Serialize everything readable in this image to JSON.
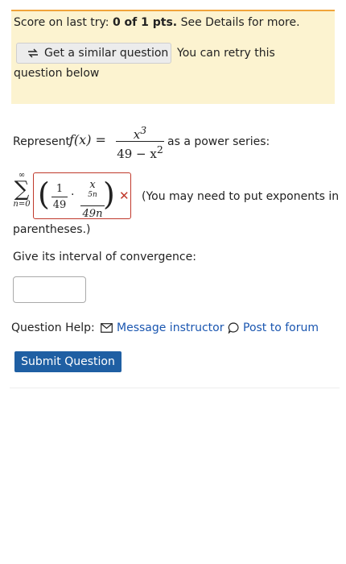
{
  "banner": {
    "score_prefix": "Score on last try: ",
    "score_value": "0 of 1 pts.",
    "score_suffix": " See Details for more.",
    "similar_button": "Get a similar question",
    "retry_line1": "You can retry this",
    "retry_line2": "question below",
    "icons": {
      "retry": "retry-icon"
    }
  },
  "question": {
    "represent_prefix": "Represent",
    "function_lhs": "f(x) =",
    "numerator": "x",
    "numerator_exp": "3",
    "denominator": "49 − x",
    "denominator_exp": "2",
    "represent_suffix": "as a power series:",
    "sum_upper": "∞",
    "sum_symbol": "∑",
    "sum_lower": "n=0",
    "answer": {
      "frac1_num": "1",
      "frac1_den": "49",
      "frac2_num": "x",
      "frac2_num_exp": "5n",
      "frac2_den": "49n",
      "status": "incorrect",
      "status_symbol": "✕"
    },
    "hint_line1": "(You may need to put exponents in",
    "hint_line2": "parentheses.)",
    "interval_label": "Give its interval of convergence:",
    "interval_value": ""
  },
  "help": {
    "label": "Question Help:",
    "message_link": "Message instructor",
    "forum_link": "Post to forum",
    "icons": {
      "message": "envelope-icon",
      "forum": "speech-bubble-icon"
    }
  },
  "submit_label": "Submit Question",
  "colors": {
    "banner_bg": "#fcf3d0",
    "banner_border": "#f0a43a",
    "link": "#1a56b0",
    "error": "#c0392b",
    "submit_bg": "#1f5fa3"
  }
}
